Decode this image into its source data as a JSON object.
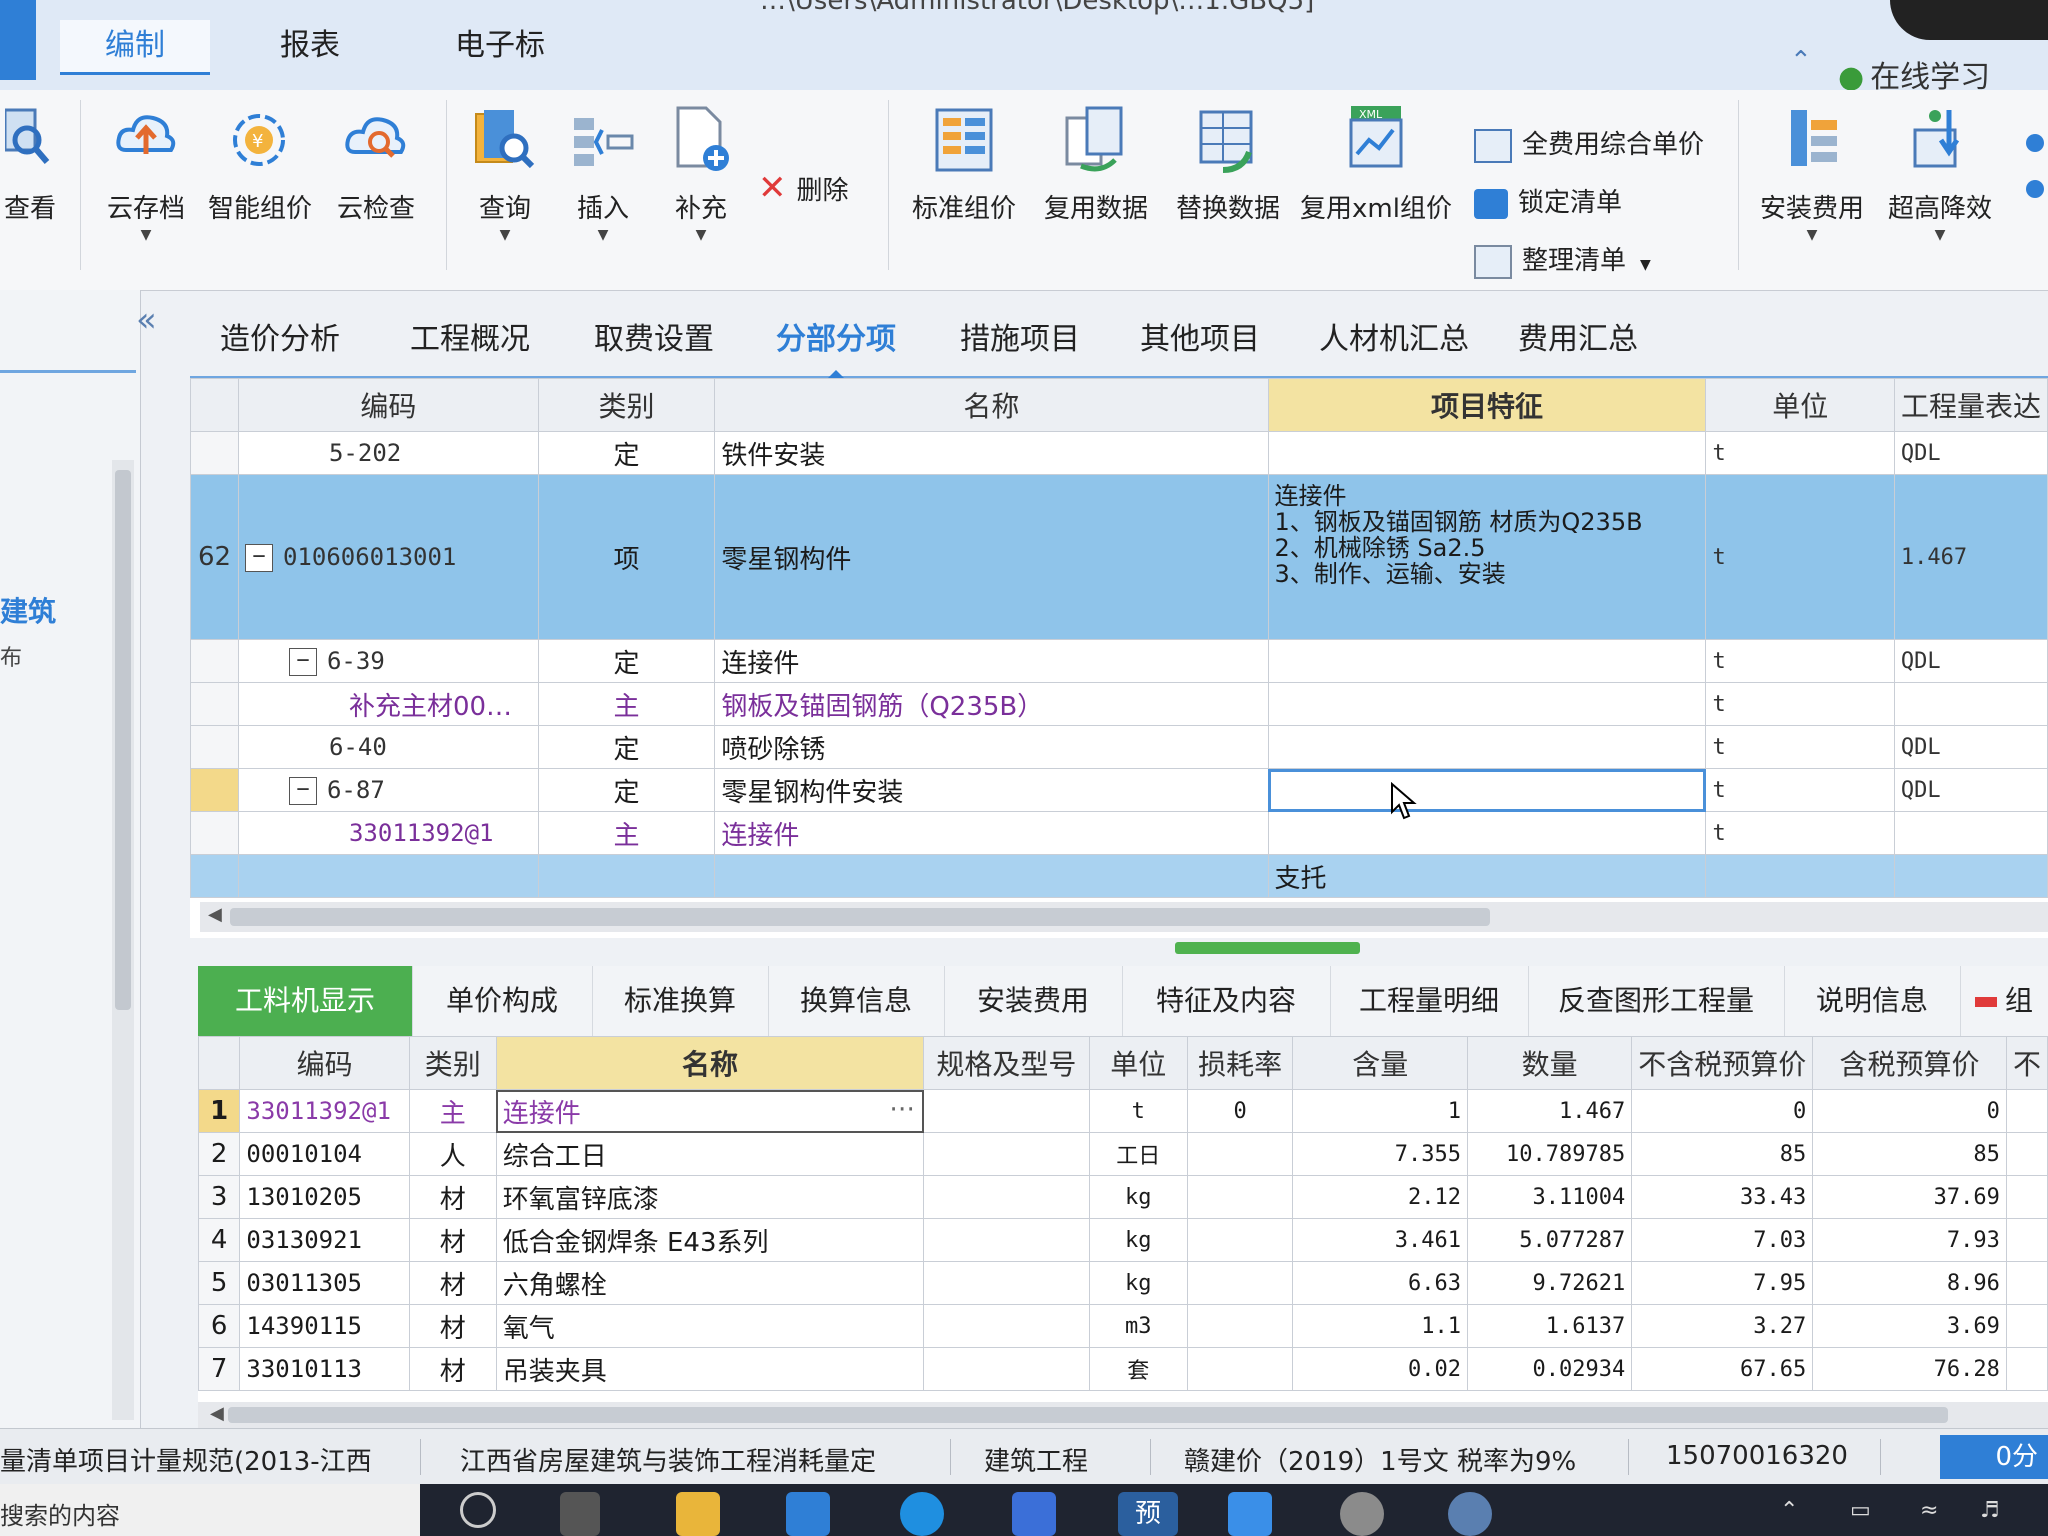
{
  "title_bar": {
    "path_text": "…\\Users\\Administrator\\Desktop\\…1.GBQ5]",
    "menu_tabs": [
      "编制",
      "报表",
      "电子标"
    ],
    "online_learn": "在线学习"
  },
  "ribbon": {
    "view": "查看",
    "cloud_save": "云存档",
    "smart_price": "智能组价",
    "cloud_check": "云检查",
    "query": "查询",
    "insert": "插入",
    "supplement": "补充",
    "delete": "删除",
    "std_price": "标准组价",
    "reuse_data": "复用数据",
    "replace_data": "替换数据",
    "reuse_xml": "复用xml组价",
    "full_cost_unit": "全费用综合单价",
    "lock_list": "锁定清单",
    "organize_list": "整理清单",
    "install_cost": "安装费用",
    "high_rise": "超高降效"
  },
  "left_nav": {
    "label_building": "建筑",
    "label_small": "布"
  },
  "module_tabs": [
    "造价分析",
    "工程概况",
    "取费设置",
    "分部分项",
    "措施项目",
    "其他项目",
    "人材机汇总",
    "费用汇总"
  ],
  "upper_grid": {
    "headers": [
      "编码",
      "类别",
      "名称",
      "项目特征",
      "单位",
      "工程量表达"
    ],
    "rows": [
      {
        "no": "",
        "code": "5-202",
        "type": "定",
        "name": "铁件安装",
        "feature": "",
        "unit": "t",
        "qty": "QDL"
      },
      {
        "no": "62",
        "code": "010606013001",
        "type": "项",
        "name": "零星钢构件",
        "feature": "连接件\n1、钢板及锚固钢筋 材质为Q235B\n2、机械除锈 Sa2.5\n3、制作、运输、安装",
        "unit": "t",
        "qty": "1.467"
      },
      {
        "no": "",
        "code": "6-39",
        "type": "定",
        "name": "连接件",
        "feature": "",
        "unit": "t",
        "qty": "QDL"
      },
      {
        "no": "",
        "code": "补充主材00…",
        "type": "主",
        "name": "钢板及锚固钢筋（Q235B）",
        "feature": "",
        "unit": "t",
        "qty": ""
      },
      {
        "no": "",
        "code": "6-40",
        "type": "定",
        "name": "喷砂除锈",
        "feature": "",
        "unit": "t",
        "qty": "QDL"
      },
      {
        "no": "",
        "code": "6-87",
        "type": "定",
        "name": "零星钢构件安装",
        "feature": "",
        "unit": "t",
        "qty": "QDL"
      },
      {
        "no": "",
        "code": "33011392@1",
        "type": "主",
        "name": "连接件",
        "feature": "",
        "unit": "t",
        "qty": ""
      },
      {
        "no": "",
        "code": "",
        "type": "",
        "name": "",
        "feature": "支托",
        "unit": "",
        "qty": ""
      }
    ]
  },
  "lower_tabs": [
    "工料机显示",
    "单价构成",
    "标准换算",
    "换算信息",
    "安装费用",
    "特征及内容",
    "工程量明细",
    "反查图形工程量",
    "说明信息",
    "组"
  ],
  "lower_grid": {
    "headers": [
      "编码",
      "类别",
      "名称",
      "规格及型号",
      "单位",
      "损耗率",
      "含量",
      "数量",
      "不含税预算价",
      "含税预算价",
      "不"
    ],
    "rows": [
      {
        "no": "1",
        "code": "33011392@1",
        "type": "主",
        "name": "连接件",
        "spec": "",
        "unit": "t",
        "loss": "0",
        "content": "1",
        "qty": "1.467",
        "price_ex": "0",
        "price_in": "0"
      },
      {
        "no": "2",
        "code": "00010104",
        "type": "人",
        "name": "综合工日",
        "spec": "",
        "unit": "工日",
        "loss": "",
        "content": "7.355",
        "qty": "10.789785",
        "price_ex": "85",
        "price_in": "85"
      },
      {
        "no": "3",
        "code": "13010205",
        "type": "材",
        "name": "环氧富锌底漆",
        "spec": "",
        "unit": "kg",
        "loss": "",
        "content": "2.12",
        "qty": "3.11004",
        "price_ex": "33.43",
        "price_in": "37.69"
      },
      {
        "no": "4",
        "code": "03130921",
        "type": "材",
        "name": "低合金钢焊条 E43系列",
        "spec": "",
        "unit": "kg",
        "loss": "",
        "content": "3.461",
        "qty": "5.077287",
        "price_ex": "7.03",
        "price_in": "7.93"
      },
      {
        "no": "5",
        "code": "03011305",
        "type": "材",
        "name": "六角螺栓",
        "spec": "",
        "unit": "kg",
        "loss": "",
        "content": "6.63",
        "qty": "9.72621",
        "price_ex": "7.95",
        "price_in": "8.96"
      },
      {
        "no": "6",
        "code": "14390115",
        "type": "材",
        "name": "氧气",
        "spec": "",
        "unit": "m3",
        "loss": "",
        "content": "1.1",
        "qty": "1.6137",
        "price_ex": "3.27",
        "price_in": "3.69"
      },
      {
        "no": "7",
        "code": "33010113",
        "type": "材",
        "name": "吊装夹具",
        "spec": "",
        "unit": "套",
        "loss": "",
        "content": "0.02",
        "qty": "0.02934",
        "price_ex": "67.65",
        "price_in": "76.28"
      }
    ]
  },
  "status_bar": {
    "s1": "量清单项目计量规范(2013-江西",
    "s2": "江西省房屋建筑与装饰工程消耗量定",
    "s3": "建筑工程",
    "s4": "赣建价（2019）1号文 税率为9%",
    "s5": "15070016320",
    "btn": "0分"
  },
  "taskbar": {
    "search_text": "搜索的内容",
    "app_label": "预"
  },
  "colors": {
    "accent": "#2f7fd6",
    "selected_row": "#8fc4ea",
    "header_highlight": "#f3e3a2",
    "active_lower_tab": "#4caf50",
    "purple_text": "#7a2f9a"
  }
}
